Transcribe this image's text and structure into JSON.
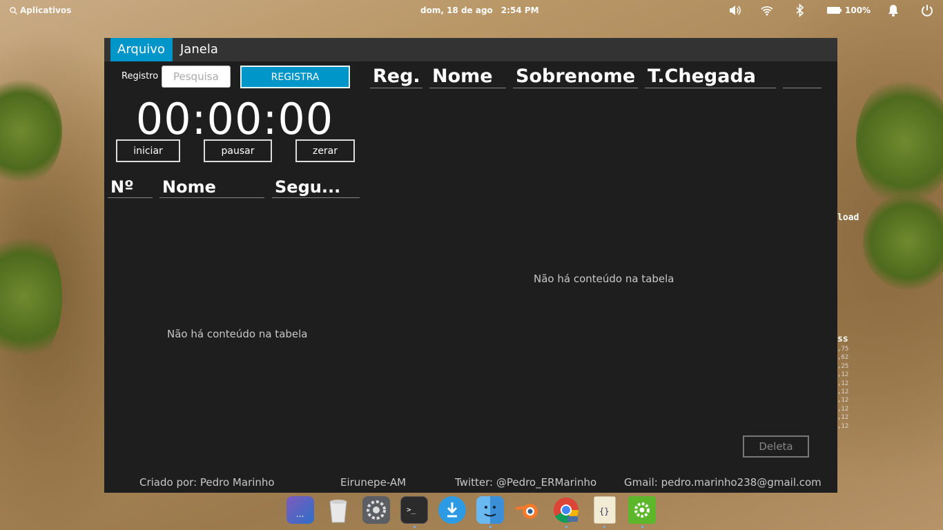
{
  "panel": {
    "apps_label": "Aplicativos",
    "date": "dom, 18 de ago",
    "time": "2:54 PM",
    "battery": "100%"
  },
  "window": {
    "menu": [
      "Arquivo",
      "Janela"
    ],
    "registro_label": "Registro",
    "search_placeholder": "Pesquisa",
    "registra_button": "REGISTRA",
    "timer": "00:00:00",
    "timer_buttons": [
      "iniciar",
      "pausar",
      "zerar"
    ],
    "left_table": {
      "columns": [
        "Nº",
        "Nome",
        "Segu..."
      ],
      "empty": "Não há conteúdo na tabela"
    },
    "right_table": {
      "columns": [
        "Reg.",
        "Nome",
        "Sobrenome",
        "T.Chegada",
        ""
      ],
      "empty": "Não há conteúdo na tabela"
    },
    "delete_button": "Deleta",
    "footer": {
      "author": "Criado por: Pedro Marinho",
      "location": "Eirunepe-AM",
      "twitter": "Twitter: @Pedro_ERMarinho",
      "gmail": "Gmail: pedro.marinho238@gmail.com"
    }
  },
  "background": {
    "load_text": "load",
    "ss_text": "ss",
    "numbers": [
      ",75",
      ",62",
      ",25",
      ",12",
      ",12",
      ",12",
      ",12",
      ",12",
      ",12",
      ",12"
    ]
  },
  "dock": [
    "multitasking-view",
    "trash",
    "system-settings",
    "terminal",
    "appcenter",
    "files",
    "blender",
    "chrome-beta",
    "code-editor",
    "settings-app"
  ],
  "colors": {
    "accent": "#0096c9",
    "window_bg": "#1e1e1e",
    "menubar_bg": "#333333"
  }
}
